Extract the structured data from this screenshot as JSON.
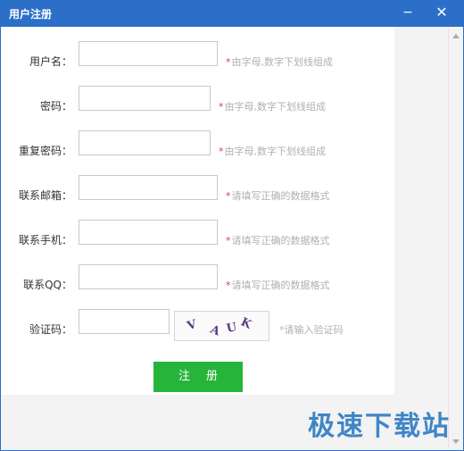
{
  "window": {
    "title": "用户注册",
    "minimize_glyph": "−",
    "close_glyph": "✕"
  },
  "form": {
    "rows": [
      {
        "label": "用户名：",
        "value": "",
        "hint_star": "*",
        "hint": "由字母,数字下划线组成"
      },
      {
        "label": "密码：",
        "value": "",
        "hint_star": "*",
        "hint": "由字母,数字下划线组成"
      },
      {
        "label": "重复密码：",
        "value": "",
        "hint_star": "*",
        "hint": "由字母,数字下划线组成"
      },
      {
        "label": "联系邮箱：",
        "value": "",
        "hint_star": "*",
        "hint": "请填写正确的数据格式"
      },
      {
        "label": "联系手机：",
        "value": "",
        "hint_star": "*",
        "hint": "请填写正确的数据格式"
      },
      {
        "label": "联系QQ：",
        "value": "",
        "hint_star": "*",
        "hint": "请填写正确的数据格式"
      }
    ],
    "captcha": {
      "label": "验证码：",
      "value": "",
      "hint": "*请输入验证码",
      "image_text": [
        "V",
        "A",
        "U",
        "K"
      ]
    },
    "submit_label": "注册"
  },
  "watermark": "极速下载站",
  "colors": {
    "titlebar": "#2b6fc9",
    "button": "#27b43a",
    "hint_star": "#e23b3b",
    "watermark": "#3f86c7"
  }
}
